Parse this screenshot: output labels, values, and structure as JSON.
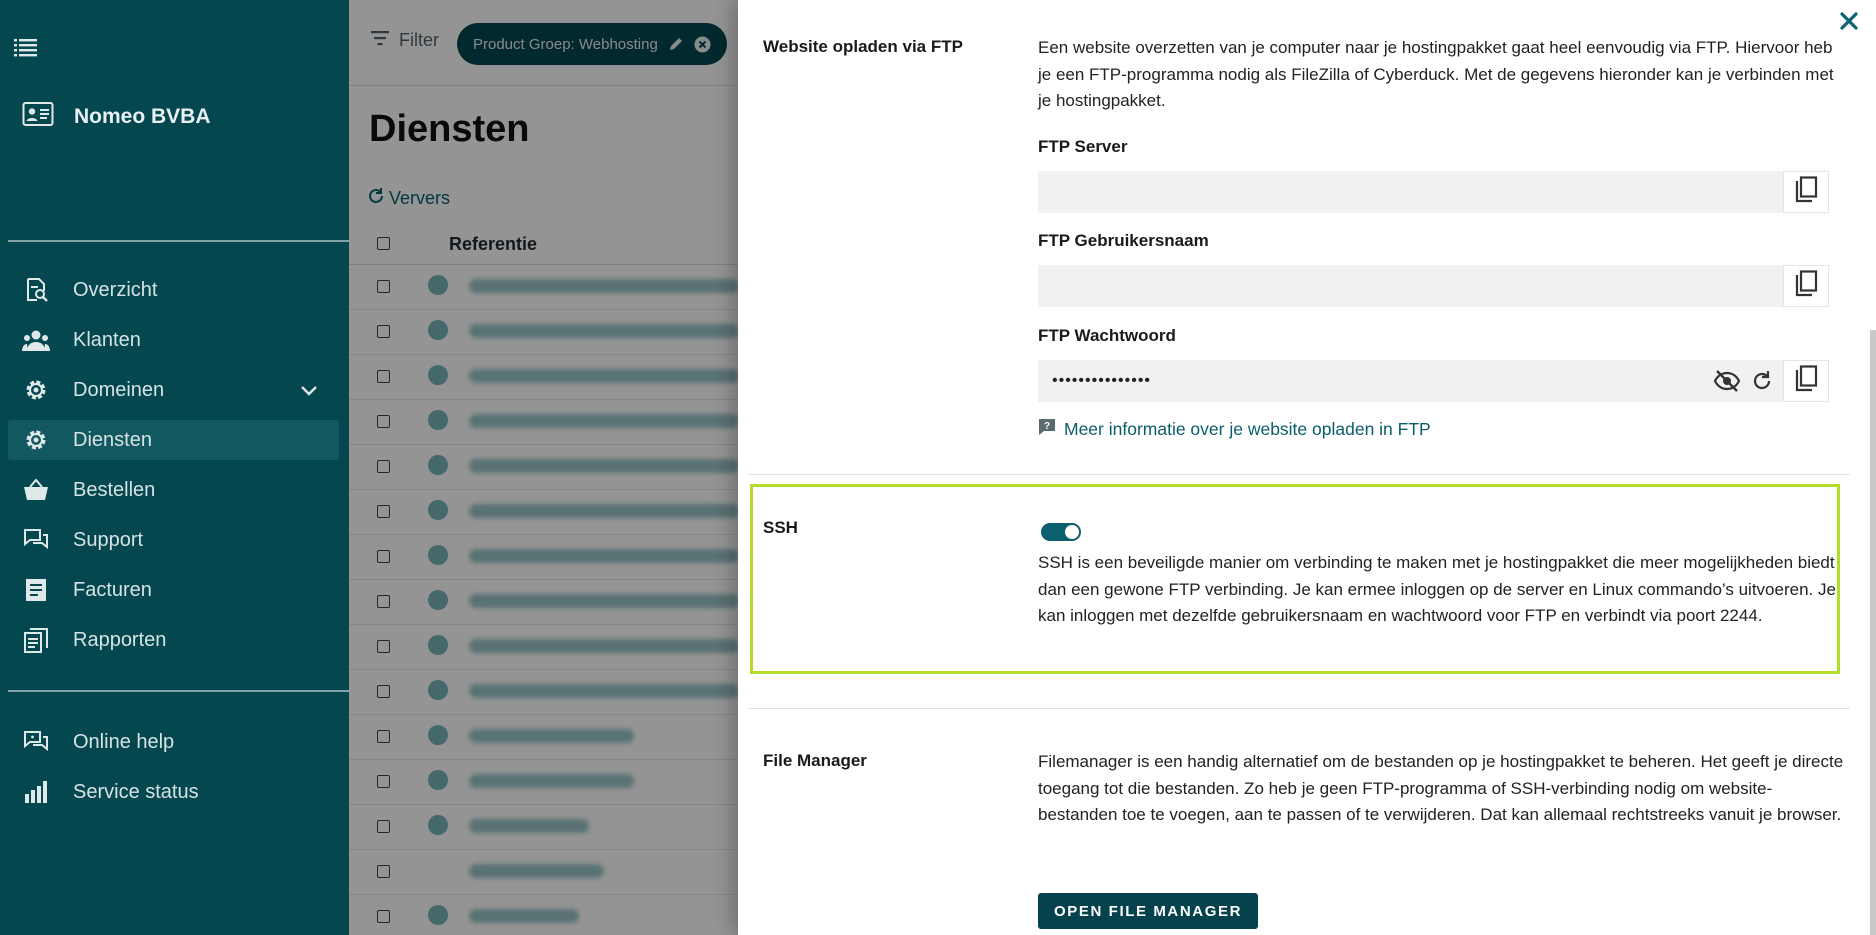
{
  "sidebar": {
    "company": "Nomeo BVBA",
    "nav_main": [
      {
        "label": "Overzicht",
        "icon": "search-document-icon"
      },
      {
        "label": "Klanten",
        "icon": "people-icon"
      },
      {
        "label": "Domeinen",
        "icon": "gear-icon",
        "expandable": true
      },
      {
        "label": "Diensten",
        "icon": "gear-icon",
        "active": true
      },
      {
        "label": "Bestellen",
        "icon": "basket-icon"
      },
      {
        "label": "Support",
        "icon": "chat-icon"
      },
      {
        "label": "Facturen",
        "icon": "invoice-icon"
      },
      {
        "label": "Rapporten",
        "icon": "reports-icon"
      }
    ],
    "nav_bottom": [
      {
        "label": "Online help",
        "icon": "help-chat-icon"
      },
      {
        "label": "Service status",
        "icon": "bar-chart-icon"
      }
    ]
  },
  "list": {
    "filter_label": "Filter",
    "chip_label": "Product Groep: Webhosting",
    "title": "Diensten",
    "refresh_label": "Ververs",
    "column_reference": "Referentie"
  },
  "drawer": {
    "ftp": {
      "title": "Website opladen via FTP",
      "description": "Een website overzetten van je computer naar je hostingpakket gaat heel eenvoudig via FTP. Hiervoor heb je een FTP-programma nodig als FileZilla of Cyberduck. Met de gegevens hieronder kan je verbinden met je hostingpakket.",
      "server_label": "FTP Server",
      "server_value": "",
      "username_label": "FTP Gebruikersnaam",
      "username_value": "",
      "password_label": "FTP Wachtwoord",
      "password_value": "•••••••••••••••",
      "info_link": "Meer informatie over je website opladen in FTP"
    },
    "ssh": {
      "title": "SSH",
      "enabled": true,
      "description": "SSH is een beveiligde manier om verbinding te maken met je hostingpakket die meer mogelijkheden biedt dan een gewone FTP verbinding. Je kan ermee inloggen op de server en Linux commando’s uitvoeren. Je kan inloggen met dezelfde gebruikersnaam en wachtwoord voor FTP en verbindt via poort 2244."
    },
    "filemanager": {
      "title": "File Manager",
      "description": "Filemanager is een handig alternatief om de bestanden op je hostingpakket te beheren. Het geeft je directe toegang tot die bestanden. Zo heb je geen FTP-programma of SSH-verbinding nodig om website-bestanden toe te voegen, aan te passen of te verwijderen. Dat kan allemaal rechtstreeks vanuit je browser.",
      "button_label": "OPEN FILE MANAGER"
    }
  },
  "colors": {
    "sidebar_bg": "#04474f",
    "primary": "#05424d",
    "highlight": "#b3dd2a",
    "link": "#0b5d6b"
  }
}
